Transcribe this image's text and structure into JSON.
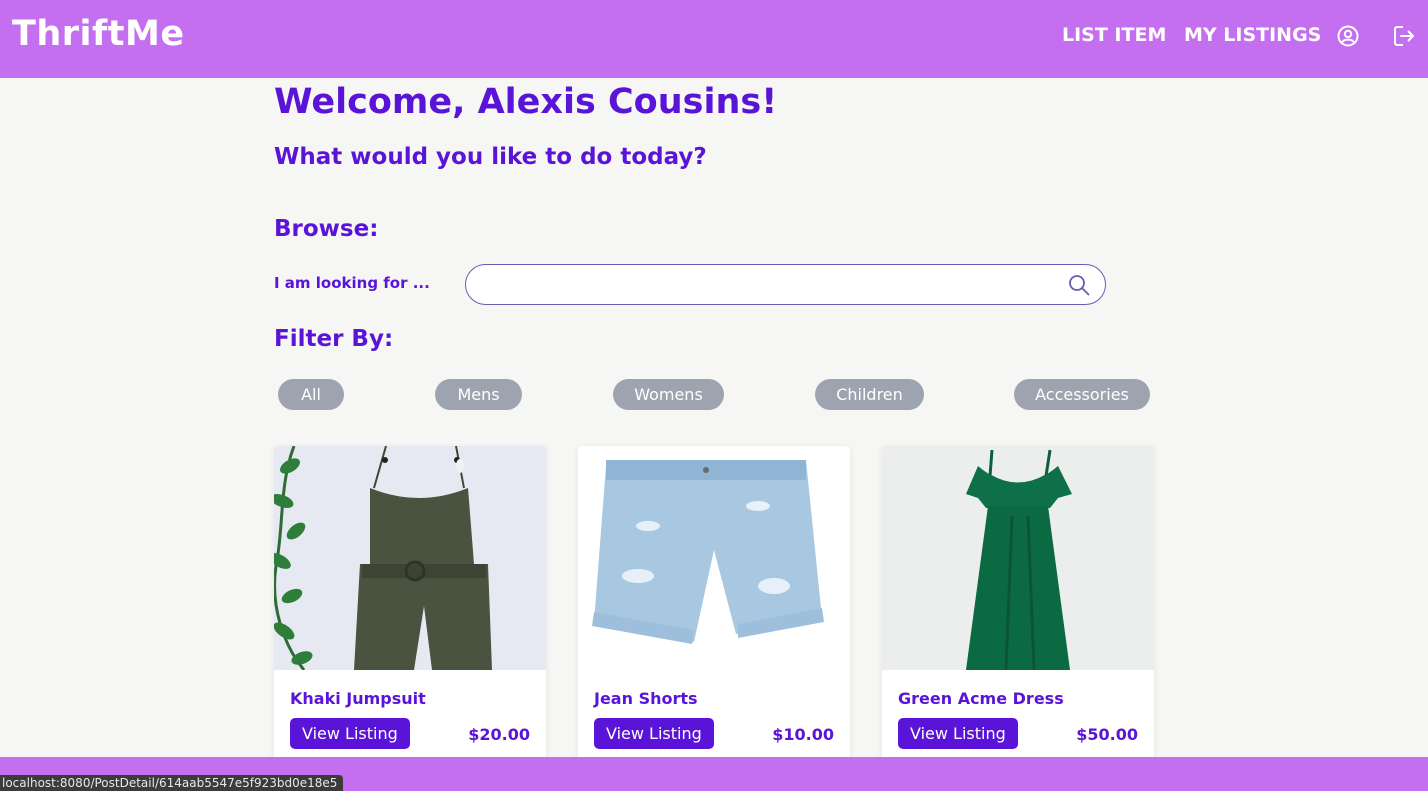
{
  "app": {
    "logo": "ThriftMe"
  },
  "nav": {
    "list_item": "LIST ITEM",
    "my_listings": "MY LISTINGS",
    "profile_icon": "user-circle-icon",
    "logout_icon": "logout-icon"
  },
  "colors": {
    "brand": "#c46ef0",
    "accent": "#5a14d8",
    "pill": "#9ea3b0",
    "background": "#f6f6f4"
  },
  "welcome": "Welcome, Alexis Cousins!",
  "subtitle": "What would you like to do today?",
  "browse": {
    "heading": "Browse:",
    "label": "I am looking for ...",
    "search_value": "",
    "search_icon": "search-icon"
  },
  "filter": {
    "heading": "Filter By:",
    "options": [
      "All",
      "Mens",
      "Womens",
      "Children",
      "Accessories"
    ]
  },
  "listings": [
    {
      "title": "Khaki Jumpsuit",
      "button": "View Listing",
      "price": "$20.00"
    },
    {
      "title": "Jean Shorts",
      "button": "View Listing",
      "price": "$10.00"
    },
    {
      "title": "Green Acme Dress",
      "button": "View Listing",
      "price": "$50.00"
    }
  ],
  "status_bar": {
    "url": "localhost:8080/PostDetail/614aab5547e5f923bd0e18e5"
  }
}
